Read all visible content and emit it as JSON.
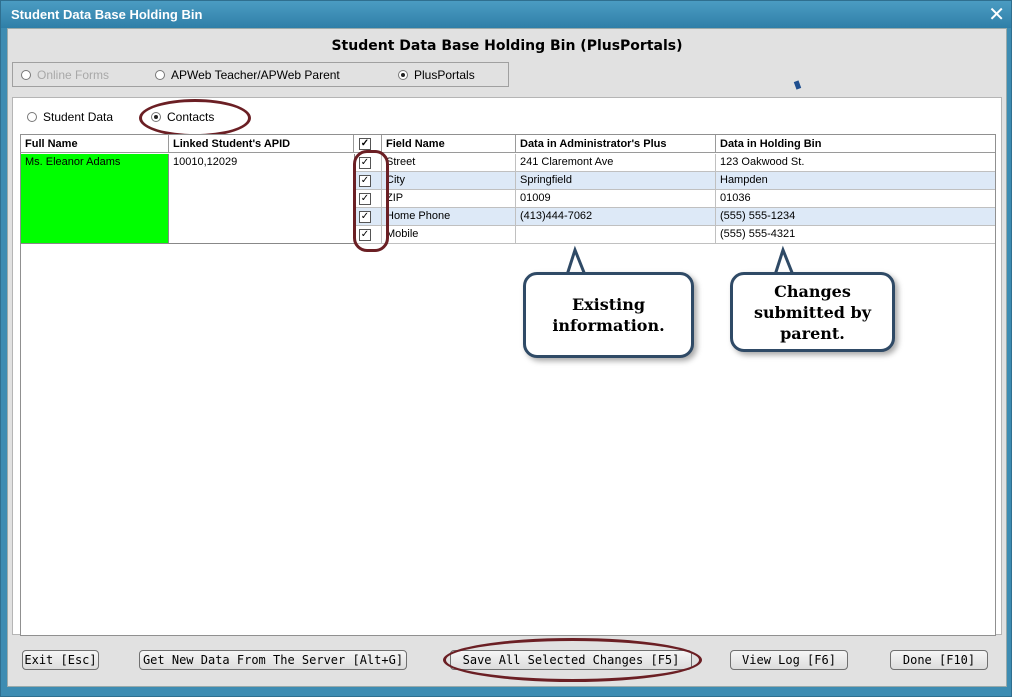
{
  "window": {
    "title": "Student Data Base Holding Bin"
  },
  "heading": "Student Data Base Holding Bin (PlusPortals)",
  "source_options": [
    {
      "label": "Online Forms",
      "selected": false,
      "enabled": false
    },
    {
      "label": "APWeb Teacher/APWeb Parent",
      "selected": false,
      "enabled": true
    },
    {
      "label": "PlusPortals",
      "selected": true,
      "enabled": true
    }
  ],
  "type_options": [
    {
      "label": "Student Data",
      "selected": false
    },
    {
      "label": "Contacts",
      "selected": true
    }
  ],
  "grid": {
    "headers": {
      "full_name": "Full Name",
      "linked_apid": "Linked Student's APID",
      "field_name": "Field Name",
      "admin_plus": "Data in Administrator's Plus",
      "holding_bin": "Data in Holding Bin"
    },
    "contact": {
      "full_name": "Ms. Eleanor Adams",
      "linked_apid": "10010,12029"
    },
    "rows": [
      {
        "field": "Street",
        "admin": "241 Claremont Ave",
        "bin": "123 Oakwood St.",
        "checked": true
      },
      {
        "field": "City",
        "admin": "Springfield",
        "bin": "Hampden",
        "checked": true
      },
      {
        "field": "ZIP",
        "admin": "01009",
        "bin": "01036",
        "checked": true
      },
      {
        "field": "Home Phone",
        "admin": "(413)444-7062",
        "bin": "(555) 555-1234",
        "checked": true
      },
      {
        "field": "Mobile",
        "admin": "",
        "bin": "(555) 555-4321",
        "checked": true
      }
    ]
  },
  "callouts": {
    "existing": "Existing information.",
    "changes": "Changes submitted by parent."
  },
  "buttons": {
    "exit": "Exit [Esc]",
    "get_new": "Get New Data From The Server [Alt+G]",
    "save_all": "Save All Selected Changes [F5]",
    "view_log": "View Log [F6]",
    "done": "Done [F10]"
  }
}
